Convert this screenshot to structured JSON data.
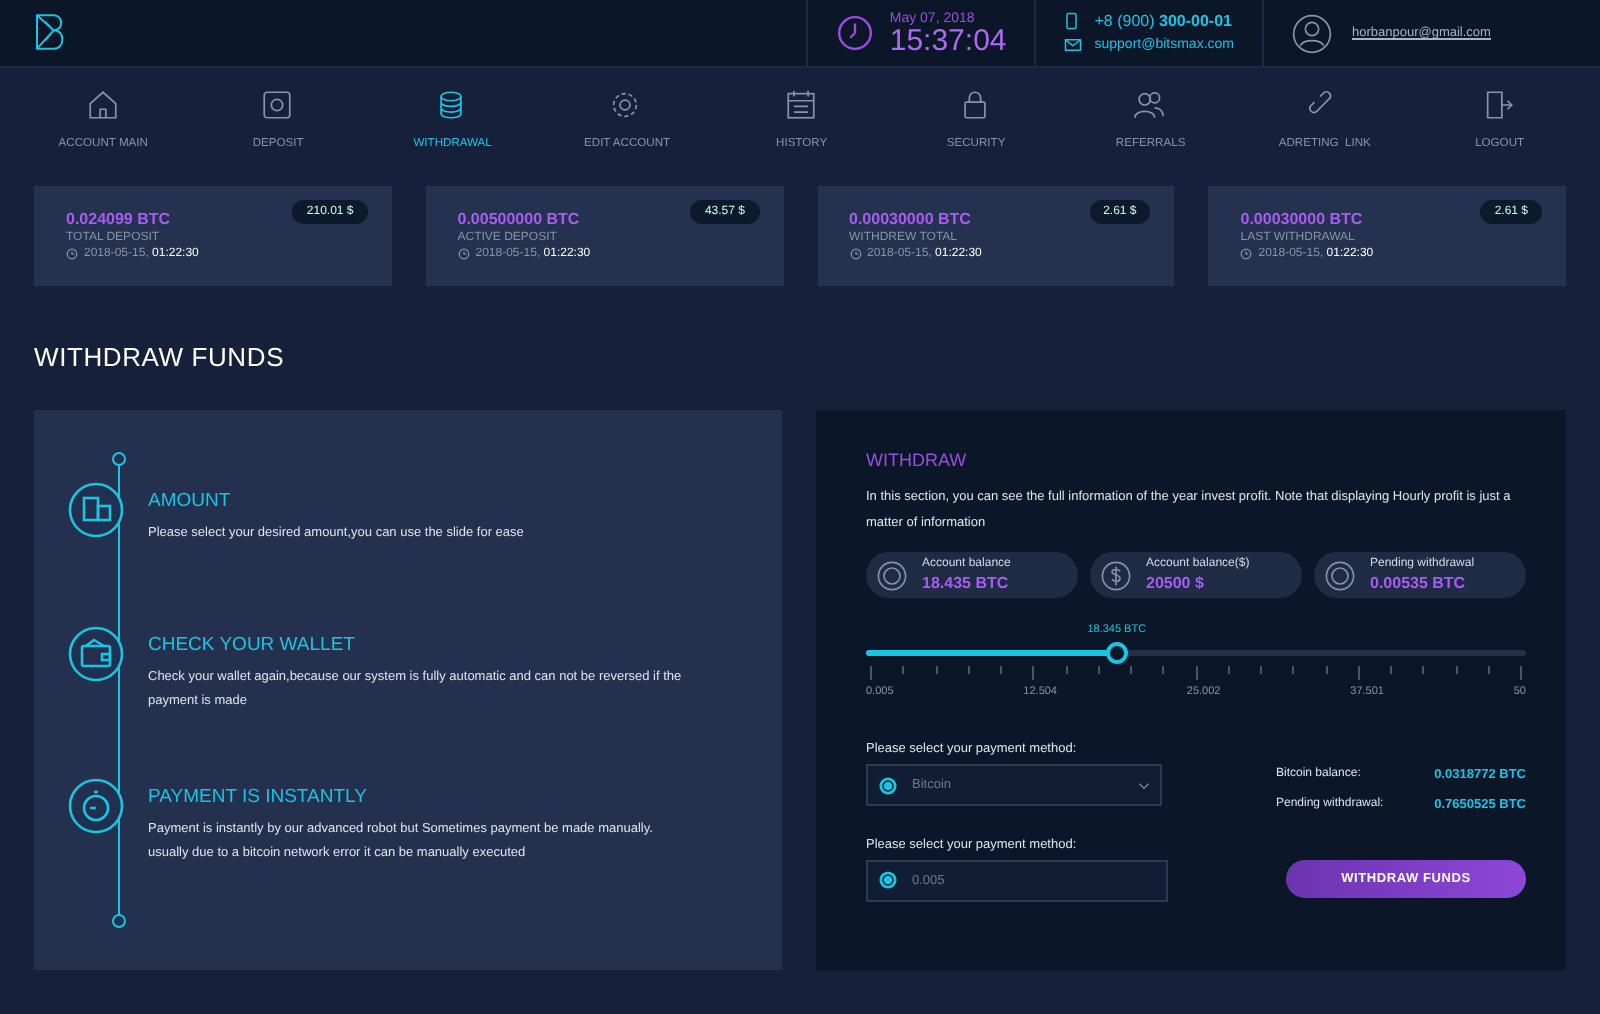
{
  "header": {
    "date": "May 07, 2018",
    "time": "15:37:04",
    "phone_prefix": "+8 (900)",
    "phone_number": "300-00-01",
    "email": "support@bitsmax.com",
    "user_email": "horbanpour@gmail.com"
  },
  "nav": [
    {
      "label": "ACCOUNT MAIN",
      "selected": false
    },
    {
      "label": "DEPOSIT",
      "selected": false
    },
    {
      "label": "WITHDRAWAL",
      "selected": true
    },
    {
      "label": "EDIT ACCOUNT",
      "selected": false
    },
    {
      "label": "HISTORY",
      "selected": false
    },
    {
      "label": "SECURITY",
      "selected": false
    },
    {
      "label": "REFERRALS",
      "selected": false
    },
    {
      "label": "ADRETING  LINK",
      "selected": false
    },
    {
      "label": "LOGOUT",
      "selected": false
    }
  ],
  "stats": [
    {
      "amount": "0.024099 BTC",
      "usd": "210.01 $",
      "label": "TOTAL DEPOSIT",
      "date": "2018-05-15,",
      "time": "01:22:30"
    },
    {
      "amount": "0.00500000 BTC",
      "usd": "43.57 $",
      "label": "ACTIVE DEPOSIT",
      "date": "2018-05-15,",
      "time": "01:22:30"
    },
    {
      "amount": "0.00030000 BTC",
      "usd": "2.61 $",
      "label": "WITHDREW TOTAL",
      "date": "2018-05-15,",
      "time": "01:22:30"
    },
    {
      "amount": "0.00030000 BTC",
      "usd": "2.61 $",
      "label": "LAST WITHDRAWAL",
      "date": "2018-05-15,",
      "time": "01:22:30"
    }
  ],
  "section_title": "WITHDRAW FUNDS",
  "steps": [
    {
      "title": "AMOUNT",
      "text": "Please select your desired amount,you can use the slide for ease"
    },
    {
      "title": "CHECK YOUR WALLET",
      "text": "Check your wallet again,because our system is fully automatic and can not be reversed if the payment is made"
    },
    {
      "title": "PAYMENT IS INSTANTLY",
      "text": "Payment is instantly by our advanced robot but Sometimes payment be made manually. usually due to a bitcoin network error it can be manually executed"
    }
  ],
  "withdraw": {
    "title": "WITHDRAW",
    "intro": "In this section, you can see the full information of the year invest profit. Note that displaying Hourly profit is just a matter of information",
    "balances": [
      {
        "label": "Account balance",
        "value": "18.435 BTC"
      },
      {
        "label": "Account balance($)",
        "value": "20500 $"
      },
      {
        "label": "Pending withdrawal",
        "value": "0.00535 BTC"
      }
    ],
    "slider": {
      "reading": "18.345 BTC",
      "level": 0.38,
      "ticks": [
        "0.005",
        "12.504",
        "25.002",
        "37.501",
        "50"
      ]
    },
    "method_label": "Please select your payment method:",
    "method_value": "Bitcoin",
    "amount_label": "Please select your payment method:",
    "amount_placeholder": "0.005",
    "info": [
      {
        "label": "Bitcoin balance:",
        "value": "0.0318772 BTC"
      },
      {
        "label": "Pending withdrawal:",
        "value": "0.7650525 BTC"
      }
    ],
    "button": "WITHDRAW FUNDS"
  }
}
